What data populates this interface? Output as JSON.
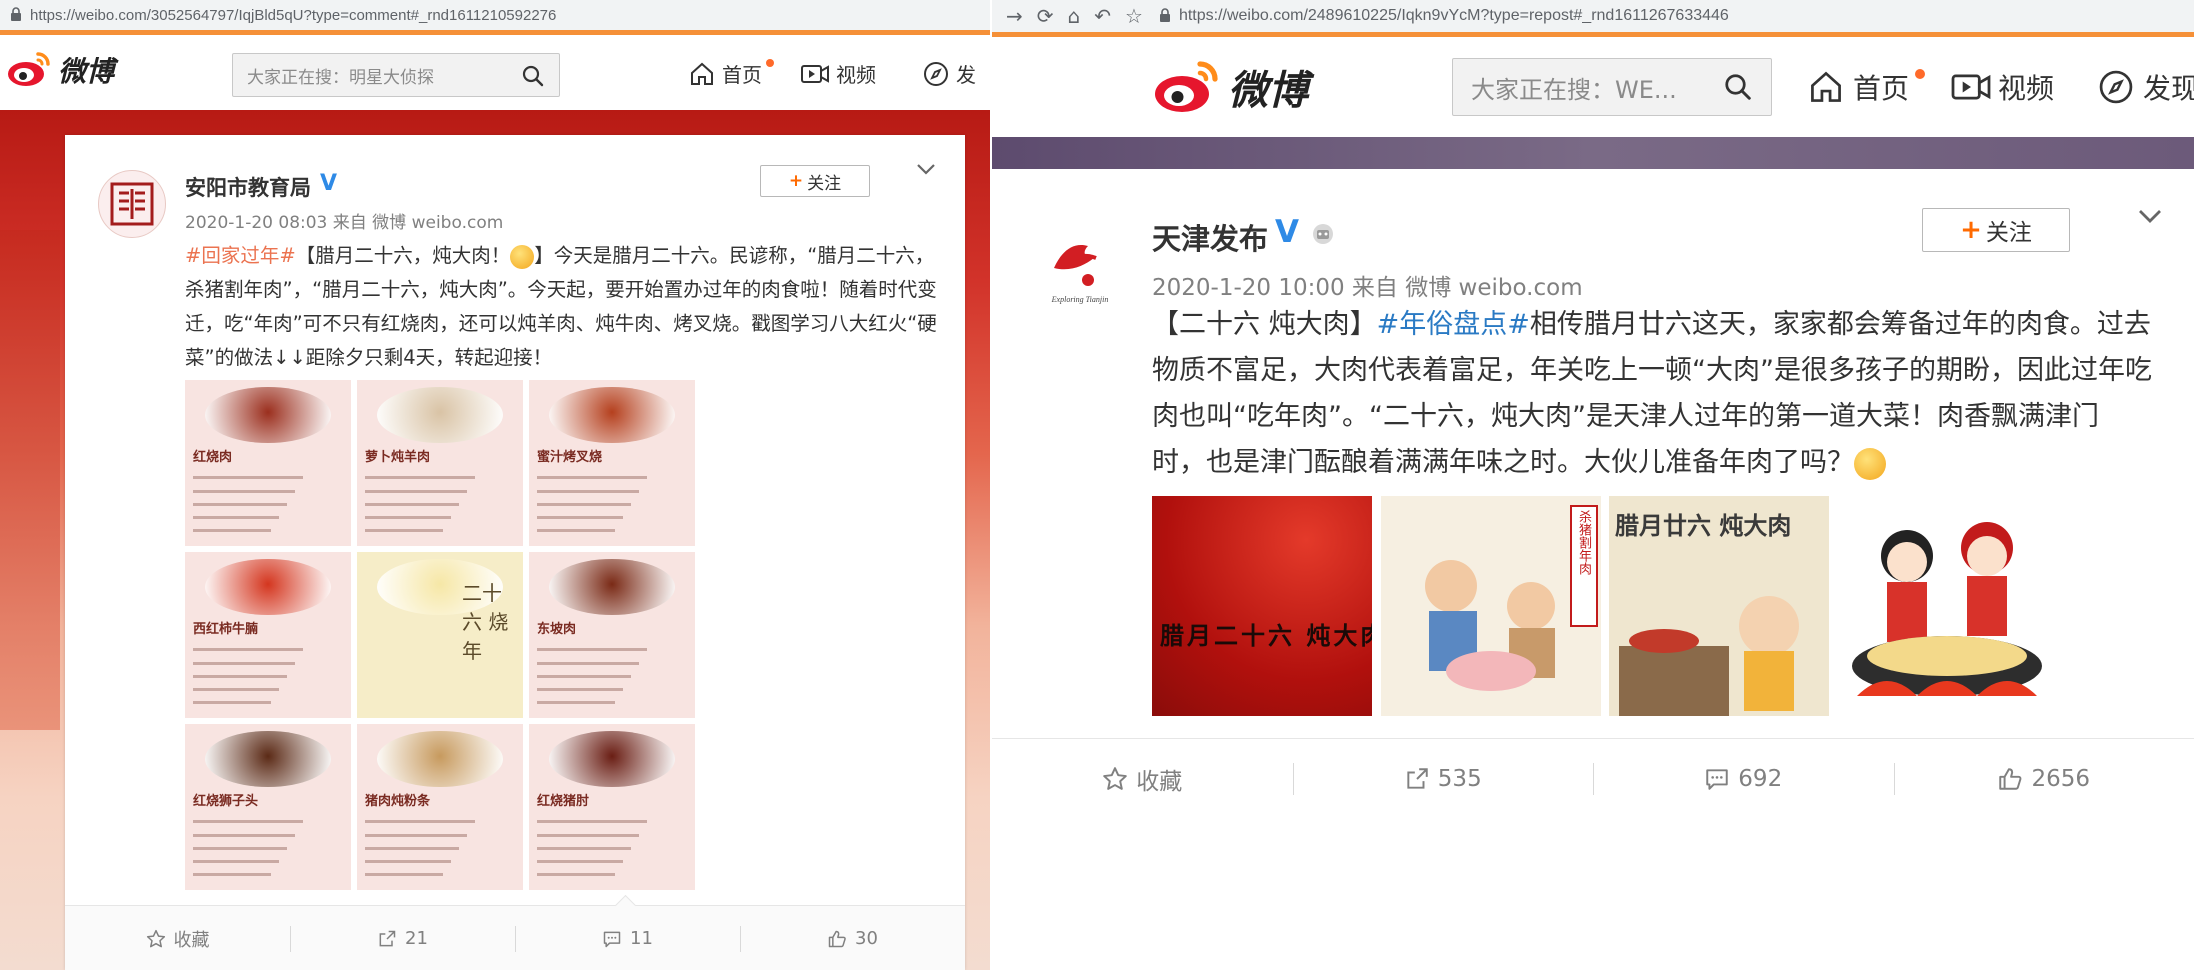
{
  "left": {
    "url": "https://weibo.com/3052564797/IqjBld5qU?type=comment#_rnd1611210592276",
    "header": {
      "logo_text": "微博",
      "search_placeholder": "大家正在搜：明星大侦探",
      "nav": [
        {
          "label": "首页",
          "icon": "home-icon"
        },
        {
          "label": "视频",
          "icon": "video-icon"
        },
        {
          "label": "发",
          "icon": "compass-icon"
        }
      ]
    },
    "post": {
      "username": "安阳市教育局",
      "verified": "V",
      "meta": "2020-1-20 08:03 来自 微博 weibo.com",
      "follow_label": "关注",
      "text_tag": "#回家过年#",
      "text_p1": "【腊月二十六，炖大肉！",
      "text_p2": "】今天是腊月二十六。民谚称，“腊月二十六，杀猪割年肉”，“腊月二十六，炖大肉”。今天起，要开始置办过年的肉食啦！随着时代变迁，吃“年肉”可不只有红烧肉，还可以炖羊肉、炖牛肉、烤叉烧。戳图学习八大红火“硬菜”的做法↓↓距除夕只剩4天，转起迎接！",
      "images": [
        "红烧肉",
        "萝卜炖羊肉",
        "蜜汁烤叉烧",
        "西红柿牛腩",
        "二十六 烧年",
        "东坡肉",
        "红烧狮子头",
        "猪肉炖粉条",
        "红烧猪肘"
      ],
      "actions": [
        {
          "label": "收藏",
          "icon": "star-icon"
        },
        {
          "label": "21",
          "icon": "share-icon"
        },
        {
          "label": "11",
          "icon": "comment-icon"
        },
        {
          "label": "30",
          "icon": "like-icon"
        }
      ]
    }
  },
  "right": {
    "url": "https://weibo.com/2489610225/Iqkn9vYcM?type=repost#_rnd1611267633446",
    "header": {
      "logo_text": "微博",
      "search_placeholder": "大家正在搜：WE...",
      "nav": [
        {
          "label": "首页",
          "icon": "home-icon"
        },
        {
          "label": "视频",
          "icon": "video-icon"
        },
        {
          "label": "发现",
          "icon": "compass-icon"
        }
      ]
    },
    "post": {
      "username": "天津发布",
      "verified": "V",
      "meta": "2020-1-20 10:00 来自 微博 weibo.com",
      "follow_label": "关注",
      "text_p1": "【二十六 炖大肉】",
      "text_tag": "#年俗盘点#",
      "text_p2": "相传腊月廿六这天，家家都会筹备过年的肉食。过去物质不富足，大肉代表着富足，年关吃上一顿“大肉”是很多孩子的期盼，因此过年吃肉也叫“吃年肉”。“二十六，炖大肉”是天津人过年的第一道大菜！肉香飘满津门时，也是津门酝酿着满满年味之时。大伙儿准备年肉了吗？",
      "images": [
        "腊月二十六 炖大肉",
        "杀猪割年肉",
        "腊月廿六 炖大肉",
        ""
      ],
      "actions": [
        {
          "label": "收藏",
          "icon": "star-icon"
        },
        {
          "label": "535",
          "icon": "share-icon"
        },
        {
          "label": "692",
          "icon": "comment-icon"
        },
        {
          "label": "2656",
          "icon": "like-icon"
        }
      ]
    }
  },
  "colors": {
    "accent": "#f59038",
    "tag_left": "#eb7350",
    "tag_right": "#2a7ac4",
    "verified": "#2e8ae6"
  }
}
